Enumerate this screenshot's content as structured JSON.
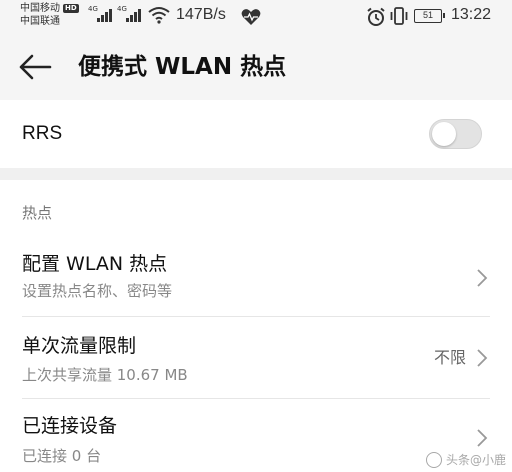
{
  "status_bar": {
    "carrier1": "中国移动",
    "hd_badge": "HD",
    "carrier2": "中国联通",
    "network_type": "4G",
    "network_type_2": "4G",
    "speed": "147B/s",
    "battery_level": "51",
    "time": "13:22",
    "icons": [
      "signal-icon",
      "wifi-icon",
      "heart-icon",
      "alarm-icon",
      "vibrate-icon",
      "battery-icon"
    ]
  },
  "header": {
    "title": "便携式 WLAN 热点"
  },
  "rrs": {
    "label": "RRS",
    "enabled": false
  },
  "hotspot": {
    "section_title": "热点",
    "items": [
      {
        "title": "配置 WLAN 热点",
        "subtitle": "设置热点名称、密码等",
        "value": ""
      },
      {
        "title": "单次流量限制",
        "subtitle": "上次共享流量 10.67 MB",
        "value": "不限"
      },
      {
        "title": "已连接设备",
        "subtitle": "已连接 0 台",
        "value": ""
      }
    ]
  },
  "watermark": {
    "text": "头条@小鹿"
  }
}
